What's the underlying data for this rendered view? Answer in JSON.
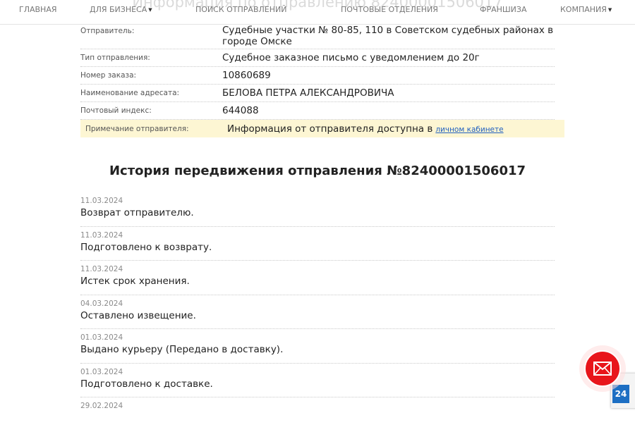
{
  "nav": {
    "ghost_title": "Информация по отправлению 82400001506017",
    "items": [
      {
        "label": "ГЛАВНАЯ",
        "has_dropdown": false
      },
      {
        "label": "ДЛЯ БИЗНЕСА",
        "has_dropdown": true
      },
      {
        "label": "ПОИСК ОТПРАВЛЕНИЙ",
        "has_dropdown": false
      },
      {
        "label": "ПОЧТОВЫЕ ОТДЕЛЕНИЯ",
        "has_dropdown": false
      },
      {
        "label": "ФРАНШИЗА",
        "has_dropdown": false
      },
      {
        "label": "КОМПАНИЯ",
        "has_dropdown": true
      }
    ]
  },
  "details": {
    "sender_label": "Отправитель:",
    "sender_value": "Судебные участки № 80-85, 110 в Советском судебных районах в городе Омске",
    "type_label": "Тип отправления:",
    "type_value": "Судебное заказное письмо с уведомлением до 20г",
    "order_label": "Номер заказа:",
    "order_value": "10860689",
    "recipient_label": "Наименование адресата:",
    "recipient_value": "БЕЛОВА ПЕТРА АЛЕКСАНДРОВИЧА",
    "index_label": "Почтовый индекс:",
    "index_value": "644088",
    "note_label": "Примечание отправителя:",
    "note_value": "Информация от отправителя доступна в",
    "note_link": "личном кабинете"
  },
  "history": {
    "title": "История передвижения отправления №82400001506017",
    "events": [
      {
        "date": "11.03.2024",
        "status": "Возврат отправителю."
      },
      {
        "date": "11.03.2024",
        "status": "Подготовлено к возврату."
      },
      {
        "date": "11.03.2024",
        "status": "Истек срок хранения."
      },
      {
        "date": "04.03.2024",
        "status": "Оставлено извещение."
      },
      {
        "date": "01.03.2024",
        "status": "Выдано курьеру (Передано в доставку)."
      },
      {
        "date": "01.03.2024",
        "status": "Подготовлено к доставке."
      },
      {
        "date": "29.02.2024",
        "status": ""
      }
    ]
  },
  "widgets": {
    "mail_icon": "envelope-icon",
    "badge_text": "24",
    "accent_red": "#e8151b",
    "badge_blue": "#1d6fc3"
  }
}
